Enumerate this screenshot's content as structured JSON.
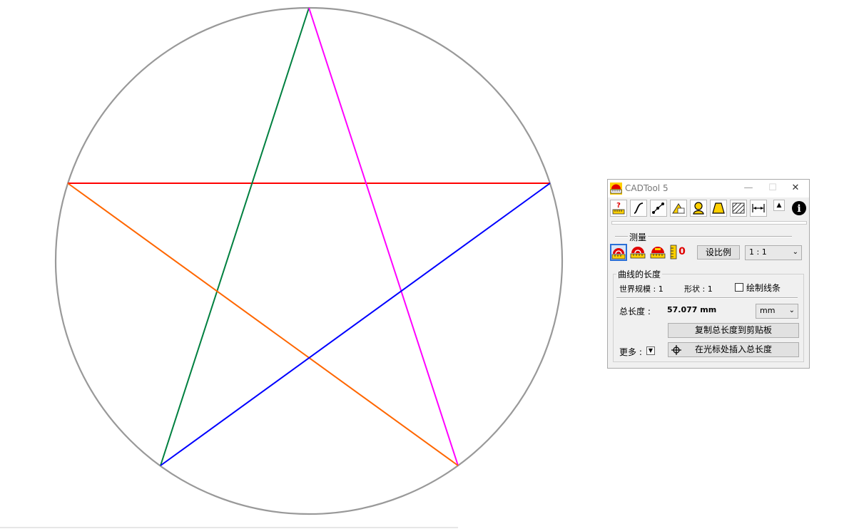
{
  "window": {
    "title": "CADTool 5",
    "minimize_glyph": "—",
    "maximize_glyph": "☐",
    "close_glyph": "✕"
  },
  "toolbar": {
    "tools": [
      "help-icon",
      "curve-icon",
      "polyline-icon",
      "area-icon",
      "user-icon",
      "shape-icon",
      "hatch-icon",
      "dimension-icon"
    ],
    "collapse_glyph": "▲",
    "info_glyph": "i"
  },
  "measure": {
    "group_label": "测量",
    "set_scale_label": "设比例",
    "scale_value": "1 : 1",
    "tools": [
      "measure-curve-icon",
      "measure-area-icon",
      "measure-volume-icon",
      "measure-zero-icon"
    ],
    "zero_glyph": "0"
  },
  "curve_length": {
    "group_label": "曲线的长度",
    "world_scale_label": "世界规模 : 1",
    "shape_label": "形状 : 1",
    "draw_lines_label": "绘制线条",
    "draw_lines_checked": false,
    "total_length_label": "总长度 :",
    "total_length_value": "57.077 mm",
    "unit_value": "mm",
    "copy_button": "复制总长度到剪贴板",
    "more_label": "更多 :",
    "more_glyph": "▼",
    "insert_button": "在光标处插入总长度"
  },
  "drawing": {
    "colors": {
      "circle": "#999999",
      "red": "#ff0000",
      "green": "#008040",
      "magenta": "#ff00ff",
      "orange": "#ff6600",
      "blue": "#0000ff"
    }
  }
}
